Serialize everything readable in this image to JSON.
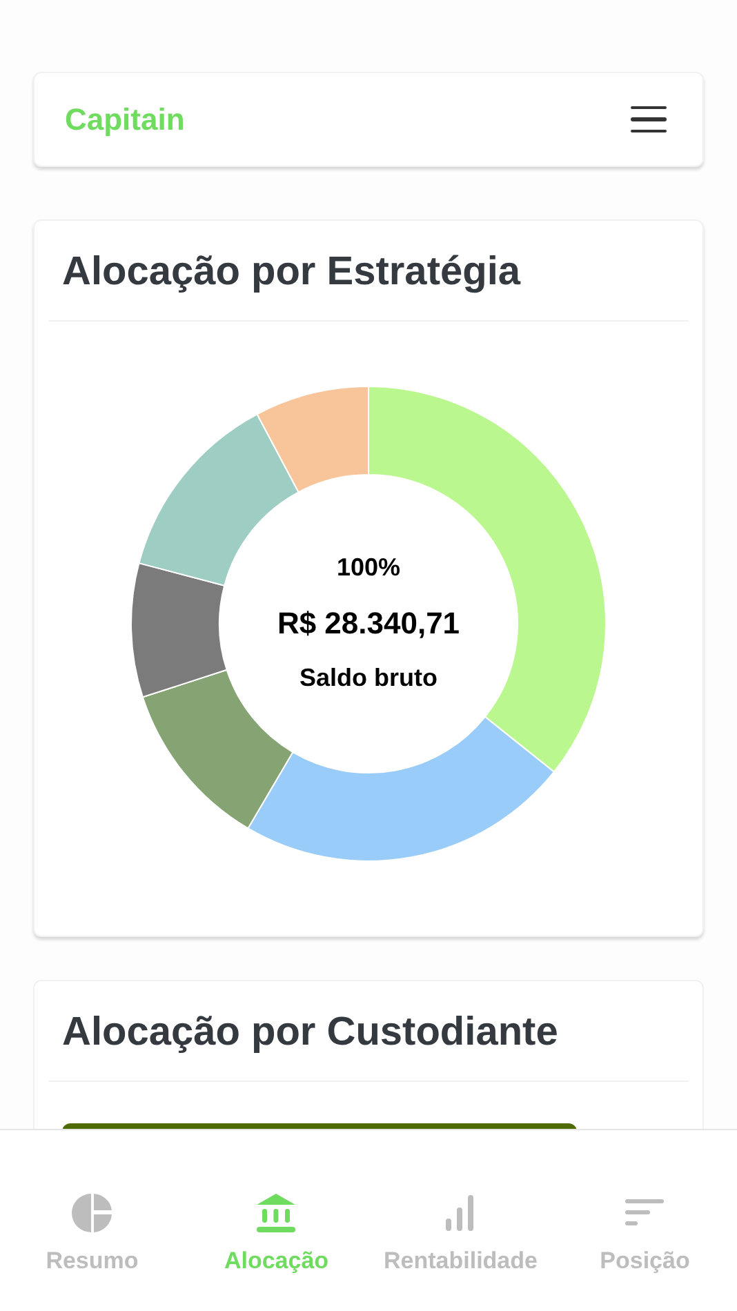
{
  "header": {
    "brand": "Capitain"
  },
  "strategy_card": {
    "title": "Alocação por Estratégia",
    "center": {
      "percent": "100%",
      "amount": "R$ 28.340,71",
      "caption": "Saldo bruto"
    }
  },
  "custodian_card": {
    "title": "Alocação por Custodiante"
  },
  "bottom_nav": [
    {
      "label": "Resumo",
      "selected": false
    },
    {
      "label": "Alocação",
      "selected": true
    },
    {
      "label": "Rentabilidade",
      "selected": false
    },
    {
      "label": "Posição",
      "selected": false
    }
  ]
}
